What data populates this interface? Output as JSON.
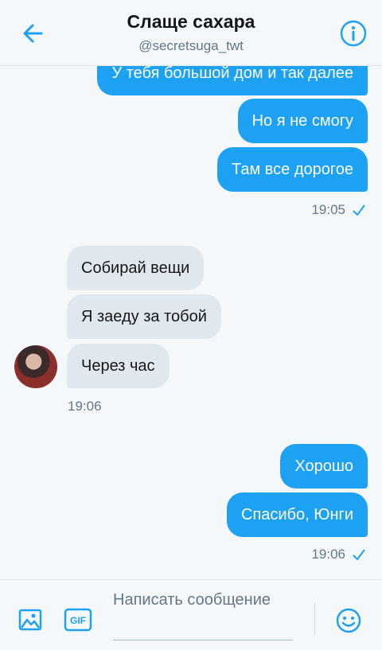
{
  "header": {
    "title": "Слаще сахара",
    "handle": "@secretsuga_twt"
  },
  "messages": [
    {
      "side": "out",
      "text": "У тебя большой дом и так далее"
    },
    {
      "side": "out",
      "text": "Но я не смогу"
    },
    {
      "side": "out",
      "text": "Там все дорогое"
    },
    {
      "side": "out",
      "time": "19:05"
    },
    {
      "side": "in",
      "text": "Собирай вещи"
    },
    {
      "side": "in",
      "text": "Я заеду за тобой"
    },
    {
      "side": "in",
      "text": "Через час"
    },
    {
      "side": "in",
      "time": "19:06"
    },
    {
      "side": "out",
      "text": "Хорошо"
    },
    {
      "side": "out",
      "text": "Спасибо, Юнги"
    },
    {
      "side": "out",
      "time": "19:06"
    }
  ],
  "composer": {
    "placeholder": "Написать сообщение",
    "gif_label": "GIF"
  },
  "colors": {
    "accent": "#1da1f2",
    "incoming_bubble": "#e1e8ed",
    "background": "#f5f8fa"
  },
  "icons": [
    "back-arrow-icon",
    "info-icon",
    "image-icon",
    "gif-icon",
    "emoji-icon",
    "read-check-icon"
  ]
}
